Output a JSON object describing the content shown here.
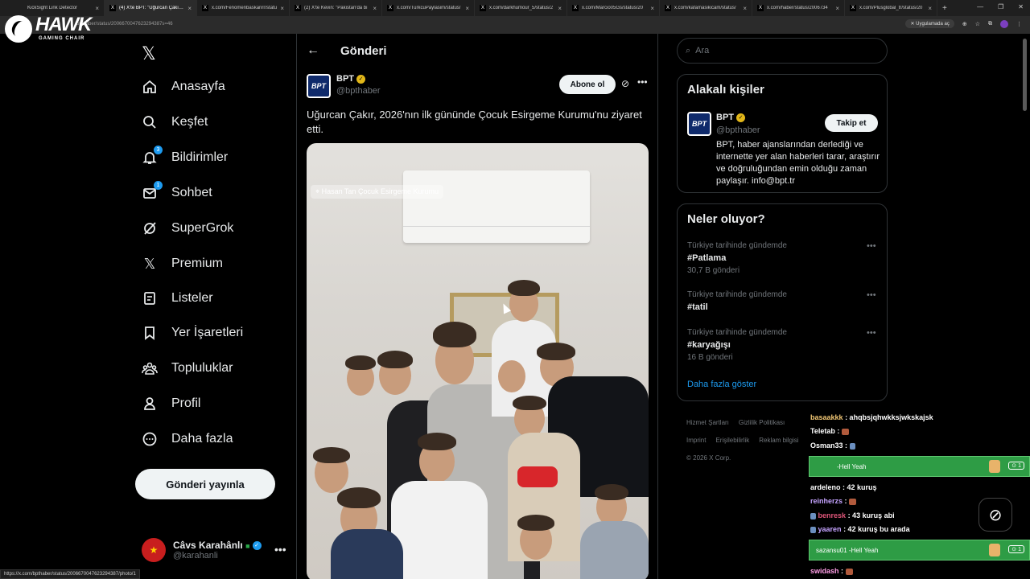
{
  "browser": {
    "tabs": [
      {
        "title": "KickSight Link Detector",
        "active": false
      },
      {
        "title": "(4) X'te BPT: \"Uğurcan Çakır, 2",
        "active": true
      },
      {
        "title": "x.com/Fenomenbaskanrr/statu",
        "active": false
      },
      {
        "title": "(2) X'te Kevin: \"Pakistan'da bi",
        "active": false
      },
      {
        "title": "x.com/TurkcuPaylasim/status/",
        "active": false
      },
      {
        "title": "x.com/darkhumour_5/status/2",
        "active": false
      },
      {
        "title": "x.com/Marcio05Gs/status/20",
        "active": false
      },
      {
        "title": "x.com/kafamasikicam/status/",
        "active": false
      },
      {
        "title": "x.com/haber/status/2006734",
        "active": false
      },
      {
        "title": "x.com/Plusglobal_tr/status/20",
        "active": false
      }
    ],
    "url": "bpthaber/status/2006670047623294387s=46",
    "app_mode": "Uygulamada aç",
    "status_url": "https://x.com/bpthaber/status/2006670047623294387/photo/1"
  },
  "overlay": {
    "brand": "HAWK",
    "brand_sub": "GAMING CHAIR"
  },
  "nav": {
    "items": [
      {
        "label": "Anasayfa",
        "icon": "home-icon",
        "badge": ""
      },
      {
        "label": "Keşfet",
        "icon": "search-icon",
        "badge": ""
      },
      {
        "label": "Bildirimler",
        "icon": "bell-icon",
        "badge": "3"
      },
      {
        "label": "Sohbet",
        "icon": "mail-icon",
        "badge": "1"
      },
      {
        "label": "SuperGrok",
        "icon": "grok-icon",
        "badge": ""
      },
      {
        "label": "Premium",
        "icon": "x-icon",
        "badge": ""
      },
      {
        "label": "Listeler",
        "icon": "list-icon",
        "badge": ""
      },
      {
        "label": "Yer İşaretleri",
        "icon": "bookmark-icon",
        "badge": ""
      },
      {
        "label": "Topluluklar",
        "icon": "people-icon",
        "badge": ""
      },
      {
        "label": "Profil",
        "icon": "person-icon",
        "badge": ""
      },
      {
        "label": "Daha fazla",
        "icon": "more-circle-icon",
        "badge": ""
      }
    ],
    "post_button": "Gönderi yayınla",
    "account": {
      "name": "Câvs Karahânlı",
      "handle": "@karahanli"
    }
  },
  "post": {
    "header": "Gönderi",
    "author": {
      "name": "BPT",
      "handle": "@bpthaber",
      "avatar_text": "BPT"
    },
    "subscribe": "Abone ol",
    "text": "Uğurcan Çakır, 2026'nın ilk gününde Çocuk Esirgeme Kurumu'nu ziyaret etti.",
    "location_tag": "Hasan Tan Çocuk Esirgeme Kurumu"
  },
  "right": {
    "search_placeholder": "Ara",
    "related": {
      "title": "Alakalı kişiler",
      "name": "BPT",
      "handle": "@bpthaber",
      "follow": "Takip et",
      "bio": "BPT, haber ajanslarından derlediği ve internette yer alan haberleri tarar, araştırır ve doğruluğundan emin olduğu zaman paylaşır. info@bpt.tr"
    },
    "trends": {
      "title": "Neler oluyor?",
      "items": [
        {
          "context": "Türkiye tarihinde gündemde",
          "tag": "#Patlama",
          "count": "30,7 B gönderi"
        },
        {
          "context": "Türkiye tarihinde gündemde",
          "tag": "#tatil",
          "count": ""
        },
        {
          "context": "Türkiye tarihinde gündemde",
          "tag": "#karyağışı",
          "count": "16 B gönderi"
        }
      ],
      "show_more": "Daha fazla göster"
    },
    "footer": {
      "links": [
        "Hizmet Şartları",
        "Gizlilik Politikası",
        "Imprint",
        "Erişilebilirlik",
        "Reklam bilgisi"
      ],
      "copyright": "© 2026 X Corp."
    }
  },
  "chat": {
    "messages": [
      {
        "user": "basaakkk",
        "text": ": ahqbsjqhwkksjwkskajsk",
        "color": "#f0c674"
      },
      {
        "user": "Teletab",
        "text": ":",
        "color": "#ffffff"
      },
      {
        "user": "Osman33",
        "text": ":",
        "color": "#ffffff"
      },
      {
        "user": "ardeleno",
        "text": ": 42 kuruş",
        "color": "#ffffff"
      },
      {
        "user": "reinherzs",
        "text": ":",
        "color": "#c5a3ff"
      },
      {
        "user": "benresk",
        "text": ": 43 kuruş abi",
        "color": "#e0567a"
      },
      {
        "user": "yaaren",
        "text": ": 42 kuruş bu arada",
        "color": "#c5a3ff"
      },
      {
        "user": "swidash",
        "text": ":",
        "color": "#ff9de6"
      }
    ],
    "highlights": [
      {
        "user": "",
        "text": "Hell Yeah",
        "count": "1"
      },
      {
        "user": "sazansu01",
        "text": "Hell Yeah",
        "count": "1"
      }
    ]
  }
}
